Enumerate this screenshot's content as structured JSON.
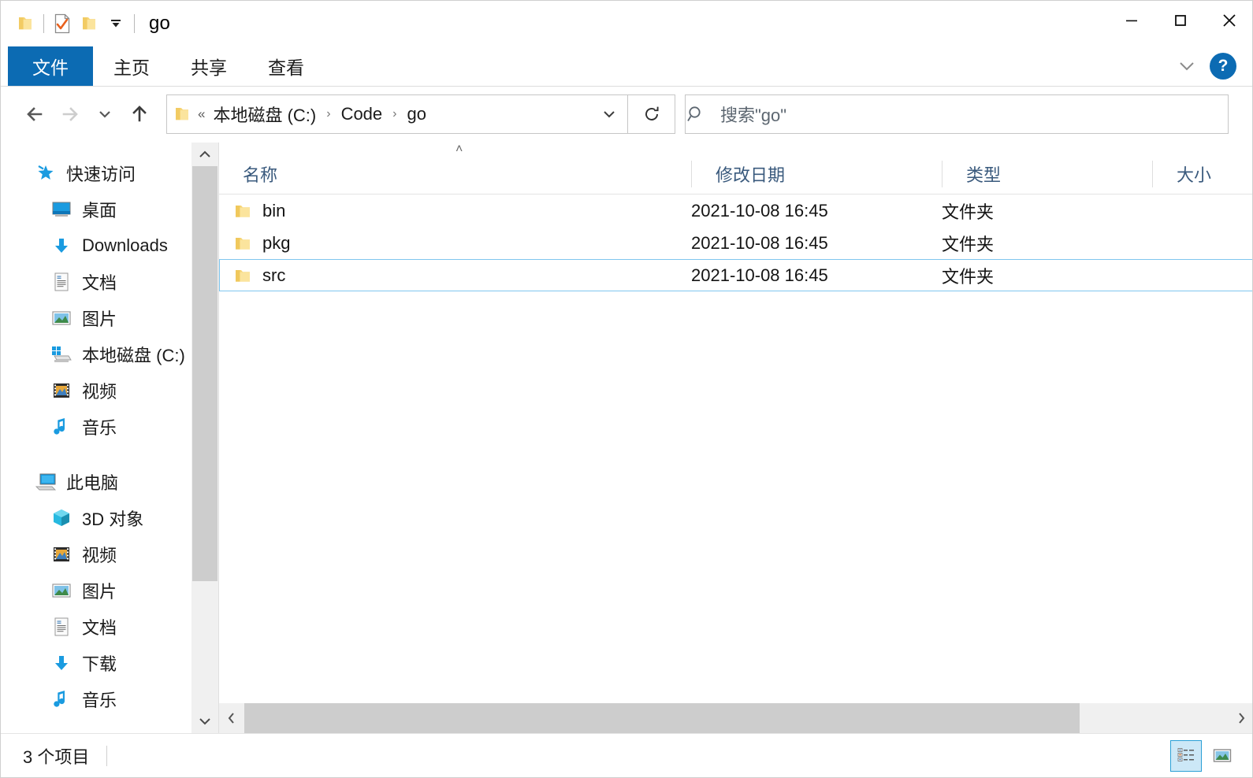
{
  "window": {
    "title": "go",
    "quick_access": [
      {
        "name": "qat-folder-icon",
        "label": "folder-icon"
      },
      {
        "name": "qat-properties-icon",
        "label": "properties-checkmark-icon"
      },
      {
        "name": "qat-new-folder-icon",
        "label": "new-folder-icon"
      },
      {
        "name": "qat-customize-dropdown",
        "label": "chevron-down-icon"
      }
    ],
    "controls": {
      "minimize": "minimize-icon",
      "maximize": "maximize-icon",
      "close": "close-icon"
    }
  },
  "ribbon": {
    "tabs": [
      {
        "label": "文件",
        "active": true
      },
      {
        "label": "主页",
        "active": false
      },
      {
        "label": "共享",
        "active": false
      },
      {
        "label": "查看",
        "active": false
      }
    ],
    "expand_icon": "chevron-down-icon",
    "help_label": "?"
  },
  "navbar": {
    "back_icon": "arrow-left-icon",
    "forward_icon": "arrow-right-icon",
    "recent_icon": "chevron-down-icon",
    "up_icon": "arrow-up-icon",
    "address": {
      "overflow": "«",
      "crumbs": [
        "本地磁盘 (C:)",
        "Code",
        "go"
      ],
      "separator": "›",
      "dropdown_icon": "chevron-down-icon"
    },
    "refresh_icon": "refresh-icon"
  },
  "search": {
    "icon": "search-icon",
    "placeholder": "搜索\"go\"",
    "value": ""
  },
  "sidebar": {
    "groups": [
      {
        "header": {
          "label": "快速访问",
          "icon": "star-pin-icon"
        },
        "items": [
          {
            "label": "桌面",
            "icon": "desktop-icon",
            "pinned": true
          },
          {
            "label": "Downloads",
            "icon": "download-arrow-icon",
            "pinned": true
          },
          {
            "label": "文档",
            "icon": "document-icon",
            "pinned": true
          },
          {
            "label": "图片",
            "icon": "picture-icon",
            "pinned": true
          },
          {
            "label": "本地磁盘 (C:)",
            "icon": "local-disk-icon",
            "pinned": true
          },
          {
            "label": "视频",
            "icon": "video-icon",
            "pinned": false
          },
          {
            "label": "音乐",
            "icon": "music-note-icon",
            "pinned": false
          }
        ]
      },
      {
        "header": {
          "label": "此电脑",
          "icon": "this-pc-icon"
        },
        "items": [
          {
            "label": "3D 对象",
            "icon": "3d-object-icon",
            "pinned": false
          },
          {
            "label": "视频",
            "icon": "video-icon",
            "pinned": false
          },
          {
            "label": "图片",
            "icon": "picture-icon",
            "pinned": false
          },
          {
            "label": "文档",
            "icon": "document-icon",
            "pinned": false
          },
          {
            "label": "下载",
            "icon": "download-arrow-icon",
            "pinned": false
          },
          {
            "label": "音乐",
            "icon": "music-note-icon",
            "pinned": false
          }
        ]
      }
    ],
    "scrollbar": {
      "up_icon": "chevron-up-icon",
      "down_icon": "chevron-down-icon"
    }
  },
  "filelist": {
    "sort_indicator": "˄",
    "columns": [
      {
        "key": "name",
        "label": "名称"
      },
      {
        "key": "date",
        "label": "修改日期"
      },
      {
        "key": "type",
        "label": "类型"
      },
      {
        "key": "size",
        "label": "大小"
      }
    ],
    "rows": [
      {
        "icon": "folder-icon",
        "name": "bin",
        "date": "2021-10-08 16:45",
        "type": "文件夹",
        "size": "",
        "selected": false
      },
      {
        "icon": "folder-icon",
        "name": "pkg",
        "date": "2021-10-08 16:45",
        "type": "文件夹",
        "size": "",
        "selected": false
      },
      {
        "icon": "folder-icon",
        "name": "src",
        "date": "2021-10-08 16:45",
        "type": "文件夹",
        "size": "",
        "selected": true
      }
    ],
    "hscroll": {
      "left_icon": "chevron-left-icon",
      "right_icon": "chevron-right-icon"
    }
  },
  "statusbar": {
    "item_count": "3 个项目",
    "views": [
      {
        "name": "details-view",
        "active": true
      },
      {
        "name": "large-icons-view",
        "active": false
      }
    ]
  },
  "colors": {
    "accent": "#0c6bb3",
    "selection_border": "#7fc6ef",
    "selection_fill": "#cce8f7",
    "column_header_text": "#3a5a7d",
    "folder_yellow": "#fbdf95"
  }
}
